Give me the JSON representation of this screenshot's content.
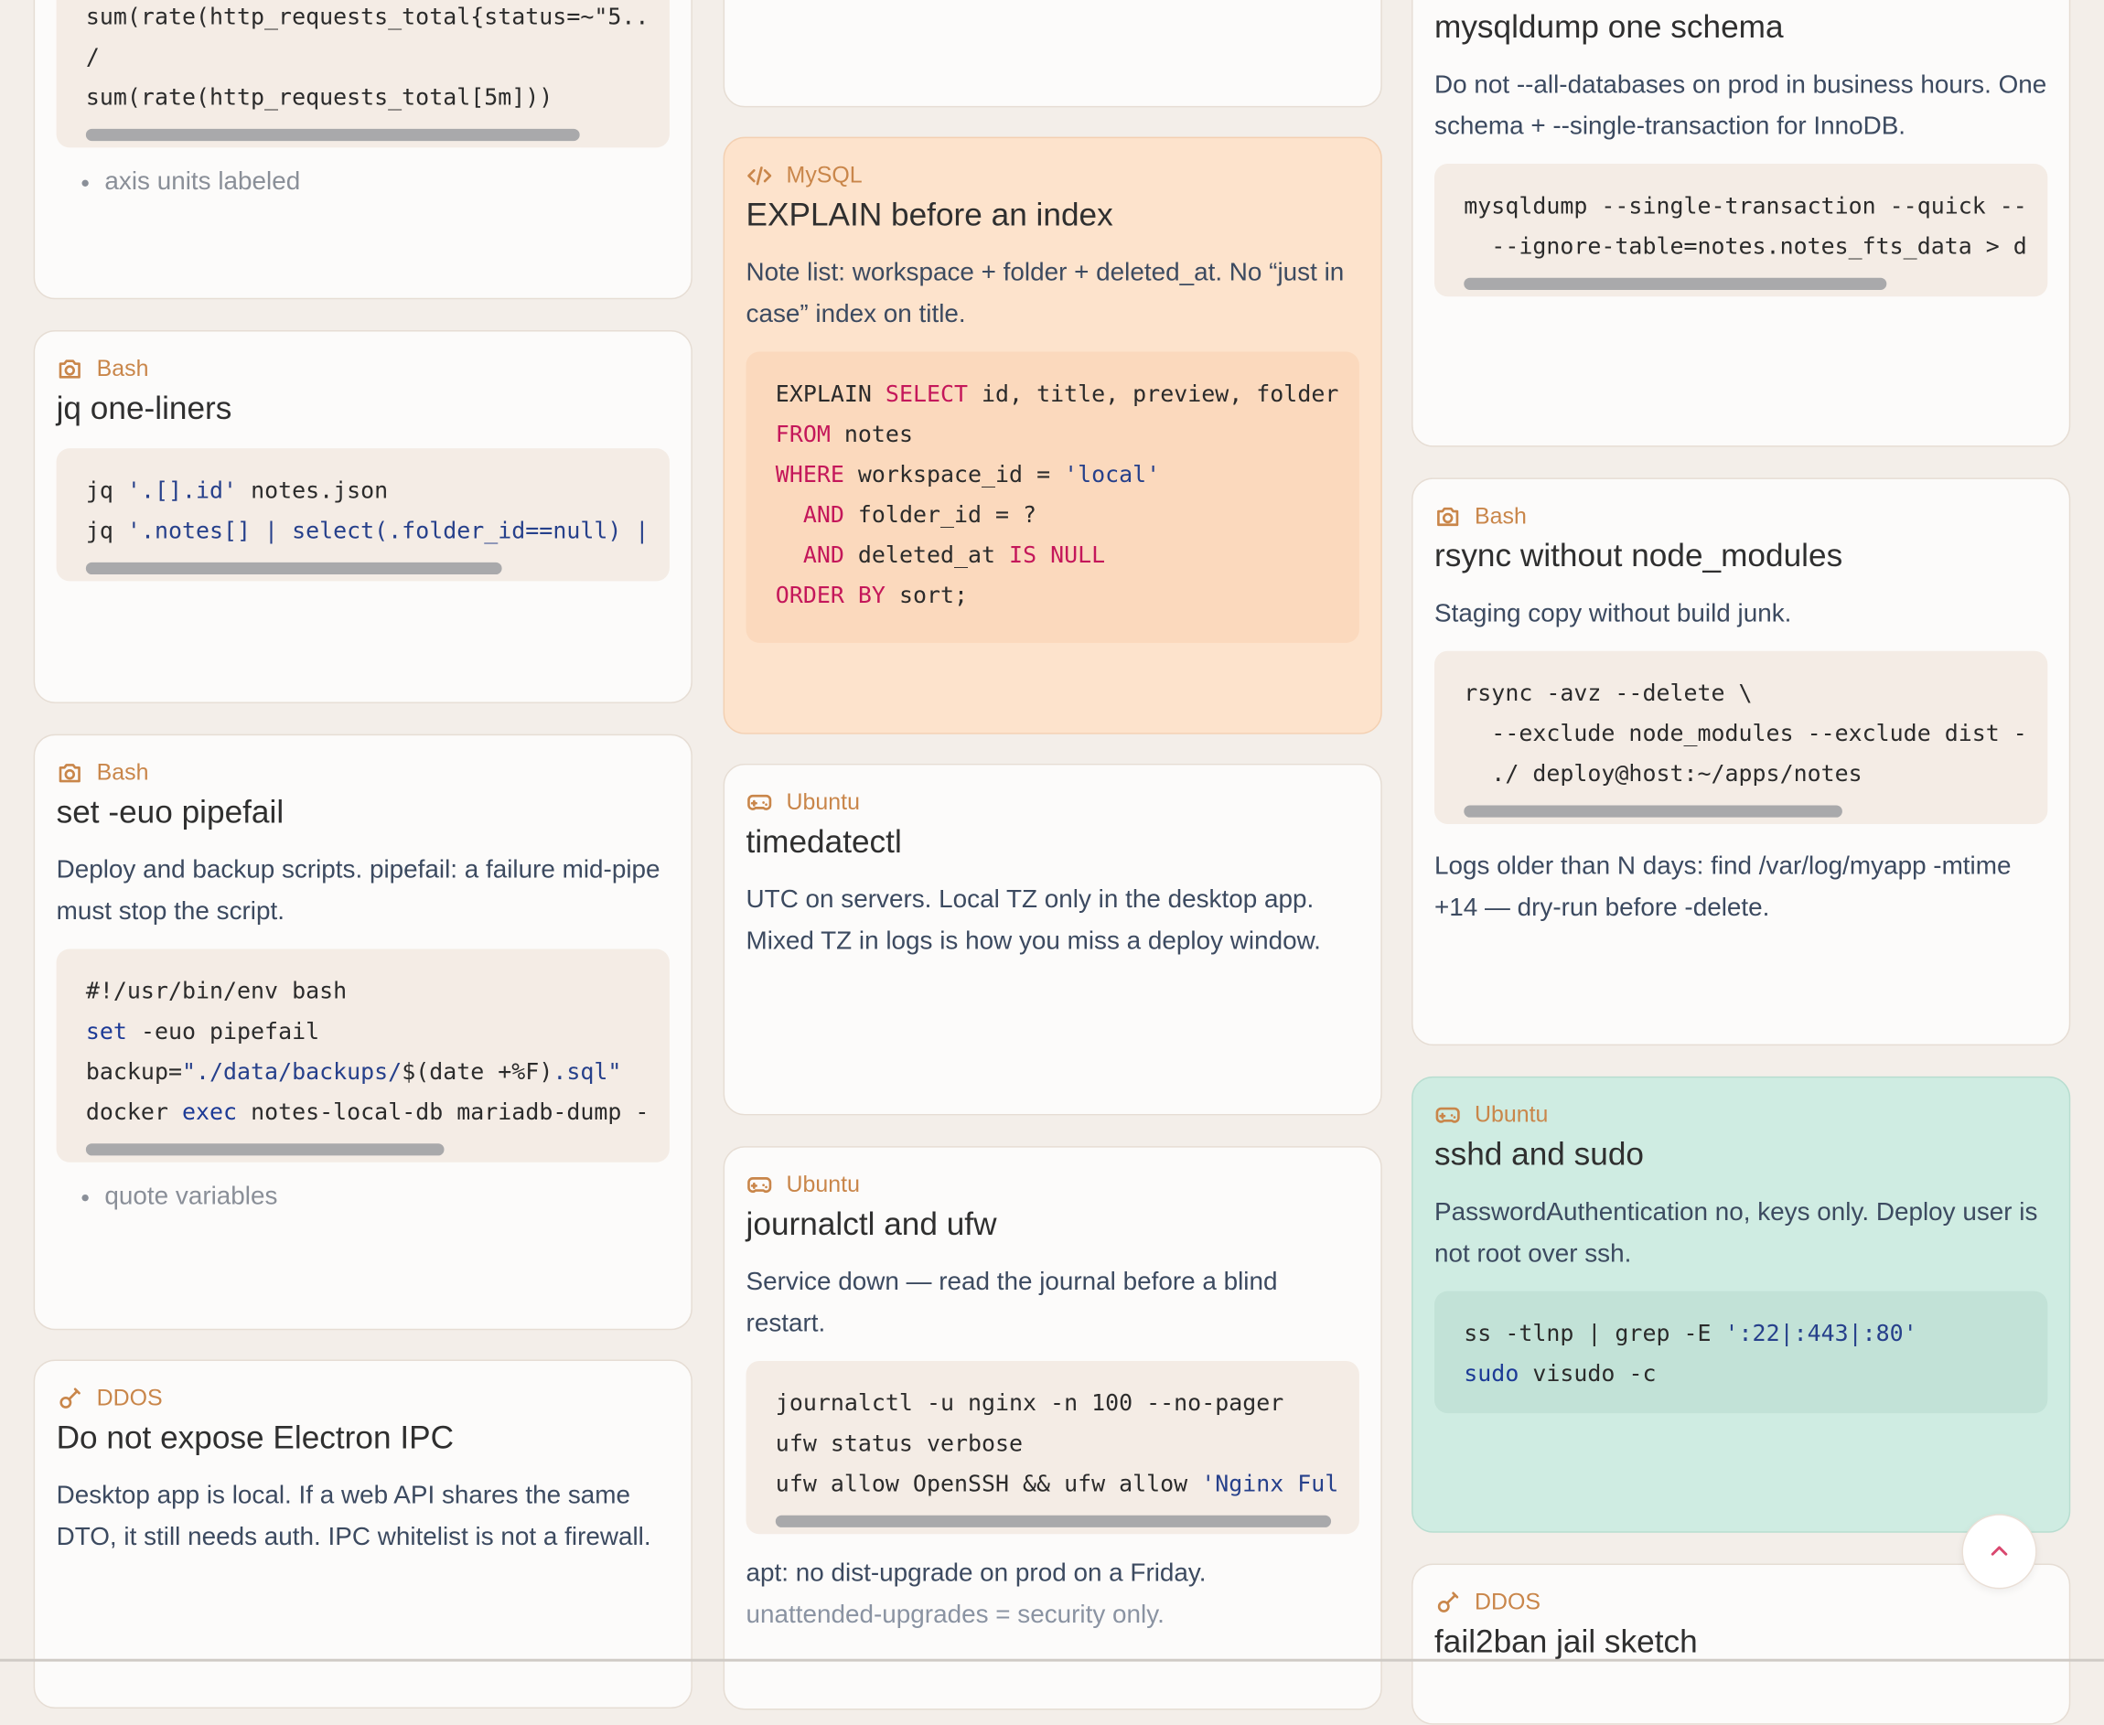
{
  "col1": {
    "card_prom": {
      "code": [
        "sum(rate(http_requests_total{status=~\"5..",
        "/",
        "sum(rate(http_requests_total[5m]))"
      ],
      "bullet": "axis units labeled"
    },
    "card_jq": {
      "tag": "Bash",
      "title": "jq one-liners",
      "code1_a": "jq ",
      "code1_b": "'.[].id'",
      "code1_c": " notes.json",
      "code2_a": "jq ",
      "code2_b": "'.notes[] | select(.folder_id==null) |"
    },
    "card_pipefail": {
      "tag": "Bash",
      "title": "set -euo pipefail",
      "desc": "Deploy and backup scripts. pipefail: a failure mid-pipe must stop the script.",
      "l1": "#!/usr/bin/env bash",
      "l2_kw": "set",
      "l2_rest": " -euo pipefail",
      "l3_a": "backup=",
      "l3_b": "\"./data/backups/",
      "l3_c": "$(date +%F)",
      "l3_d": ".sql\"",
      "l4_a": "docker ",
      "l4_b": "exec",
      "l4_c": " notes-local-db mariadb-dump -",
      "bullet": "quote variables"
    },
    "card_electron": {
      "tag": "DDOS",
      "title": "Do not expose Electron IPC",
      "desc": "Desktop app is local. If a web API shares the same DTO, it still needs auth. IPC whitelist is not a firewall."
    }
  },
  "col2": {
    "card_explain": {
      "tag": "MySQL",
      "title": "EXPLAIN before an index",
      "desc": "Note list: workspace + folder + deleted_at. No “just in case” index on title.",
      "l1_a": "EXPLAIN ",
      "l1_b": "SELECT",
      "l1_c": " id, title, preview, folder",
      "l2_a": "FROM",
      "l2_b": " notes",
      "l3_a": "WHERE",
      "l3_b": " workspace_id = ",
      "l3_c": "'local'",
      "l4_a": "  AND",
      "l4_b": " folder_id = ?",
      "l5_a": "  AND",
      "l5_b": " deleted_at ",
      "l5_c": "IS NULL",
      "l6_a": "ORDER BY",
      "l6_b": " sort;"
    },
    "card_timedatectl": {
      "tag": "Ubuntu",
      "title": "timedatectl",
      "desc": "UTC on servers. Local TZ only in the desktop app. Mixed TZ in logs is how you miss a deploy window."
    },
    "card_journal": {
      "tag": "Ubuntu",
      "title": "journalctl and ufw",
      "desc": "Service down — read the journal before a blind restart.",
      "l1": "journalctl -u nginx -n 100 --no-pager",
      "l2": "ufw status verbose",
      "l3_a": "ufw allow OpenSSH && ufw allow ",
      "l3_b": "'Nginx Ful",
      "trail": "apt: no dist-upgrade on prod on a Friday.",
      "trail_fade": "unattended-upgrades = security only."
    }
  },
  "col3": {
    "card_mysqldump": {
      "title": "mysqldump one schema",
      "desc": "Do not --all-databases on prod in business hours. One schema + --single-transaction for InnoDB.",
      "l1": "mysqldump --single-transaction --quick --",
      "l2": "  --ignore-table=notes.notes_fts_data > d"
    },
    "card_rsync": {
      "tag": "Bash",
      "title": "rsync without node_modules",
      "desc": "Staging copy without build junk.",
      "l1": "rsync -avz --delete \\",
      "l2": "  --exclude node_modules --exclude dist -",
      "l3": "  ./ deploy@host:~/apps/notes",
      "trail": "Logs older than N days: find /var/log/myapp -mtime +14 — dry-run before -delete."
    },
    "card_sshd": {
      "tag": "Ubuntu",
      "title": "sshd and sudo",
      "desc": "PasswordAuthentication no, keys only. Deploy user is not root over ssh.",
      "l1_a": "ss -tlnp | grep -E ",
      "l1_b": "':22|:443|:80'",
      "l2_a": "sudo",
      "l2_b": " visudo -c"
    },
    "card_fail2ban": {
      "tag": "DDOS",
      "title": "fail2ban jail sketch"
    }
  },
  "colors": {
    "tag": "#c9864a",
    "peach_card": "#fde3cc",
    "mint_card": "#cfece2",
    "keyword": "#c4175a",
    "string": "#26408b"
  },
  "icons": {
    "bash": "camera-icon",
    "mysql": "code-icon",
    "ubuntu": "gamepad-icon",
    "ddos": "guitar-icon",
    "back_to_top": "chevron-up-icon"
  }
}
